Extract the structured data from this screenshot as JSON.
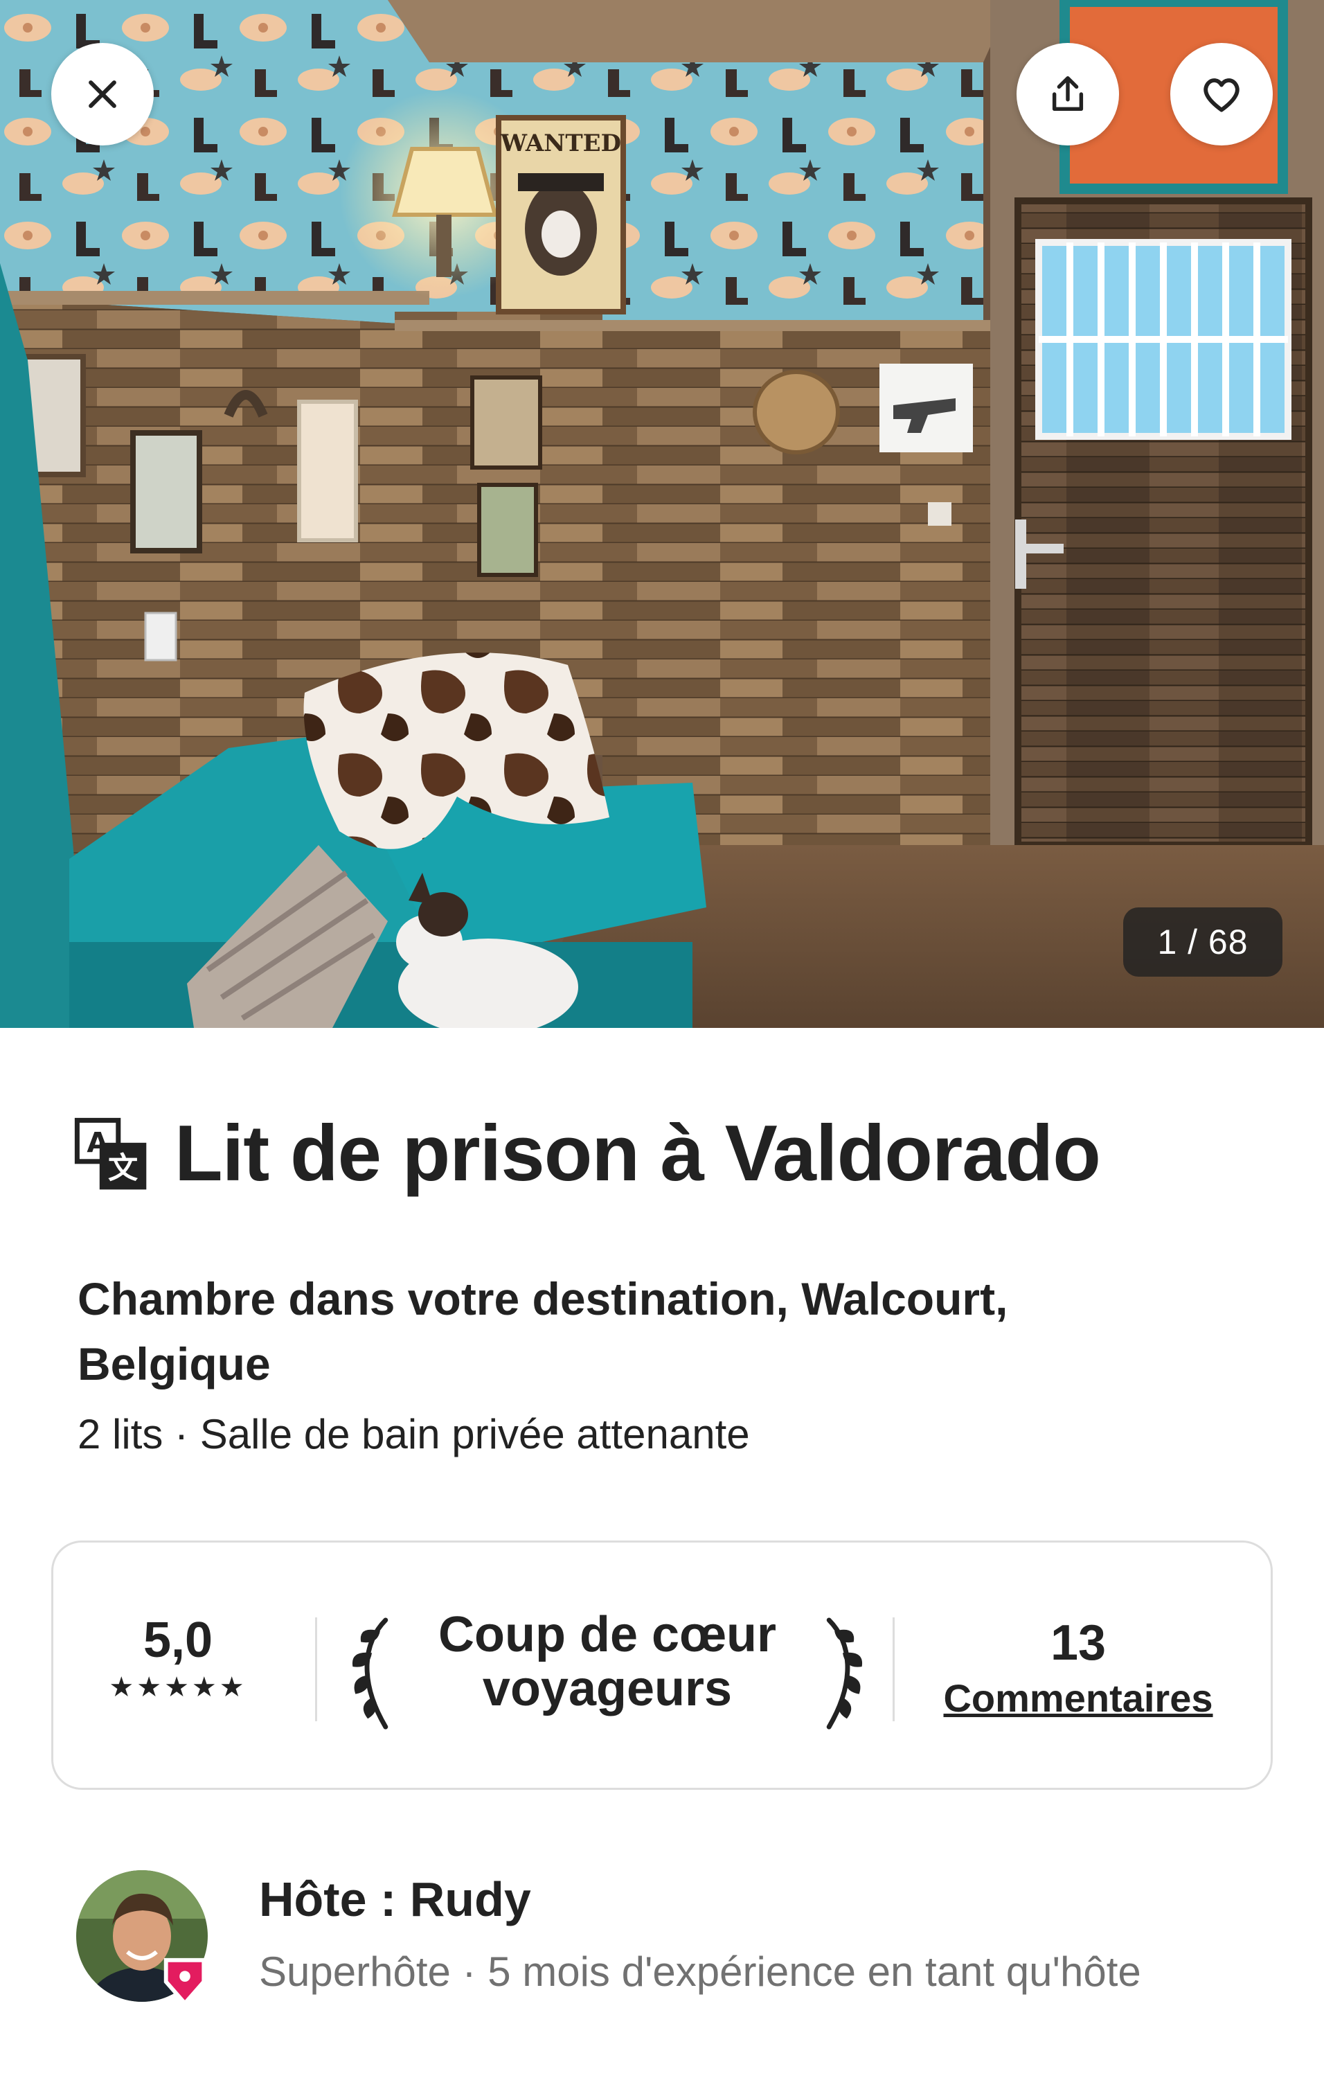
{
  "gallery": {
    "counter": "1 / 68",
    "wanted_poster_text": "WANTED"
  },
  "listing": {
    "title": "Lit de prison à Valdorado",
    "subtitle": "Chambre dans votre destination, Walcourt, Belgique",
    "details": "2 lits · Salle de bain privée attenante"
  },
  "rating_card": {
    "rating_value": "5,0",
    "stars": "★★★★★",
    "guest_favorite": "Coup de cœur voyageurs",
    "reviews_count": "13",
    "reviews_label": "Commentaires"
  },
  "host": {
    "name": "Hôte : Rudy",
    "meta": "Superhôte · 5 mois d'expérience en tant qu'hôte"
  },
  "icons": {
    "close": "close-icon",
    "share": "share-icon",
    "favorite": "heart-icon",
    "translate": "translate-icon",
    "laurel": "laurel-icon",
    "superhost": "superhost-badge-icon"
  },
  "colors": {
    "text": "#222222",
    "muted_text": "#717171",
    "border": "#dddddd",
    "badge": "#e31c5f",
    "sofa": "#1a9fa8",
    "wallpaper": "#7cc0cf"
  }
}
